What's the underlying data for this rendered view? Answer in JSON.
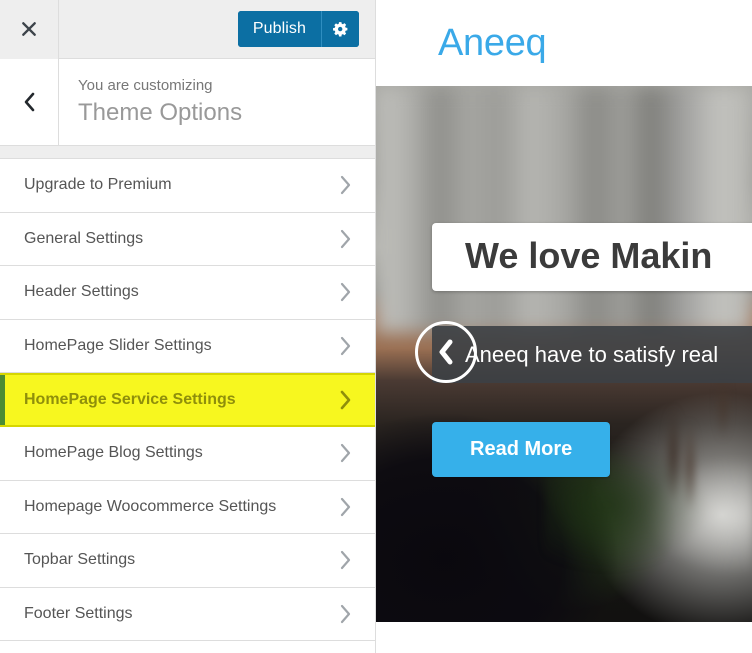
{
  "customizer": {
    "close_label": "Close",
    "publish_label": "Publish",
    "gear_label": "Publish settings",
    "back_label": "Back",
    "eyebrow": "You are customizing",
    "panel_title": "Theme Options",
    "sections": [
      {
        "label": "Upgrade to Premium",
        "highlighted": false
      },
      {
        "label": "General Settings",
        "highlighted": false
      },
      {
        "label": "Header Settings",
        "highlighted": false
      },
      {
        "label": "HomePage Slider Settings",
        "highlighted": false
      },
      {
        "label": "HomePage Service Settings",
        "highlighted": true
      },
      {
        "label": "HomePage Blog Settings",
        "highlighted": false
      },
      {
        "label": "Homepage Woocommerce Settings",
        "highlighted": false
      },
      {
        "label": "Topbar Settings",
        "highlighted": false
      },
      {
        "label": "Footer Settings",
        "highlighted": false
      }
    ],
    "colors": {
      "publish_blue": "#0c6fa3",
      "highlight_yellow": "#f7f71f",
      "highlight_text": "#8f8f0b",
      "highlight_accent": "#4c8c34"
    }
  },
  "preview": {
    "site_title": "Aneeq",
    "slider": {
      "headline": "We love Makin",
      "caption": "Aneeq have to satisfy real",
      "button_label": "Read More",
      "prev_label": "Previous slide"
    },
    "colors": {
      "site_title": "#3aa9e8",
      "button_blue": "#36b0ea",
      "caption_bg": "#3c4045"
    }
  }
}
